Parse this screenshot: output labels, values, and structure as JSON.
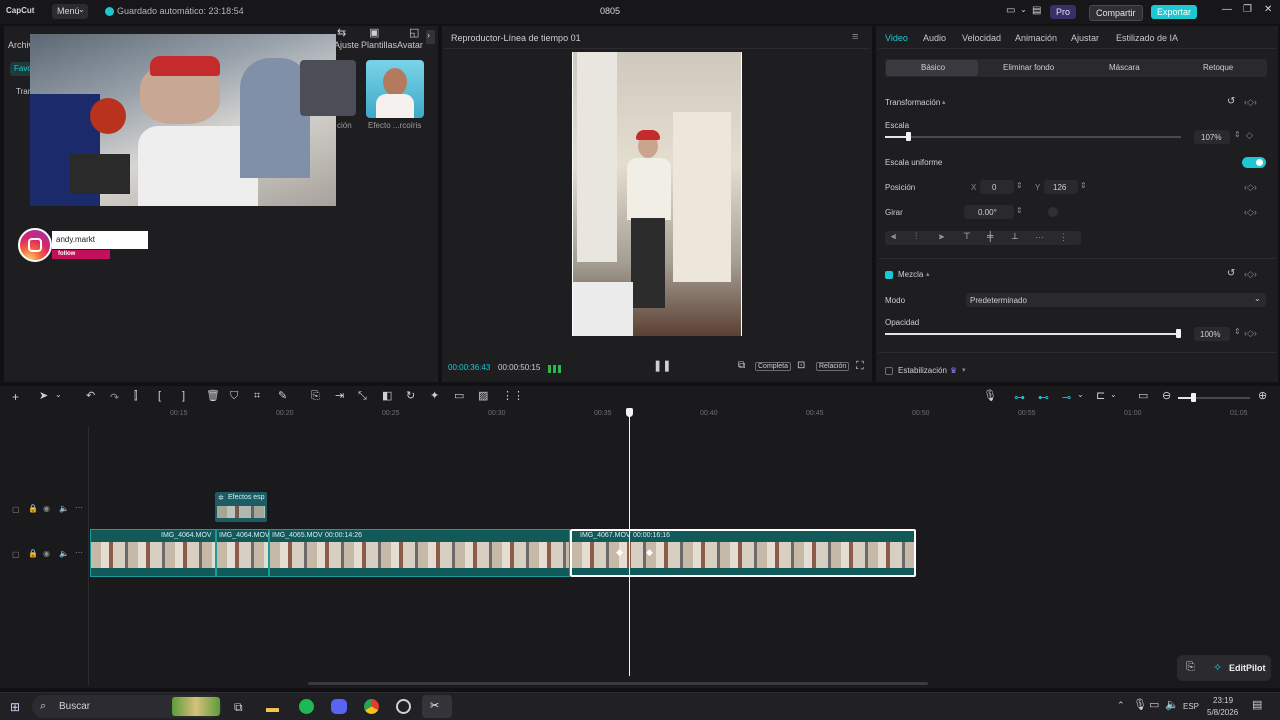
{
  "titlebar": {
    "app_logo": "CapCut",
    "menu_label": "Menú",
    "autosave": "Guardado automático: 23:18:54",
    "project_name": "0805",
    "pro_label": "Pro",
    "share_label": "Compartir",
    "export_label": "Exportar"
  },
  "media": {
    "tabs": [
      "Archivo",
      "Ajuste",
      "Plantillas",
      "Avatar"
    ],
    "side_tabs": [
      "Favo",
      "Tran"
    ],
    "cards": [
      {
        "label": "ción"
      },
      {
        "label": "Efecto ...rcoíris"
      }
    ],
    "overlay_username": "andy.markt",
    "overlay_follow": "follow"
  },
  "player": {
    "title": "Reproductor-Línea de tiempo 01",
    "current_time": "00:00:36:43",
    "total_time": "00:00:50:15",
    "btn_complete": "Completa",
    "btn_ratio": "Relación"
  },
  "props": {
    "tabs": [
      "Video",
      "Audio",
      "Velocidad",
      "Animación",
      "Ajustar",
      "Estilizado de IA"
    ],
    "active_tab": "Video",
    "subtabs": [
      "Básico",
      "Eliminar fondo",
      "Máscara",
      "Retoque"
    ],
    "section_transform": "Transformación",
    "scale_label": "Escala",
    "scale_value": "107%",
    "scale_fraction": 0.07,
    "uniform_scale_label": "Escala uniforme",
    "position_label": "Posición",
    "pos_x_label": "X",
    "pos_x": "0",
    "pos_y_label": "Y",
    "pos_y": "126",
    "rotate_label": "Girar",
    "rotate_value": "0.00°",
    "section_blend": "Mezcla",
    "mode_label": "Modo",
    "mode_value": "Predeterminado",
    "opacity_label": "Opacidad",
    "opacity_value": "100%",
    "opacity_fraction": 1.0,
    "stabilization_label": "Estabilización"
  },
  "timeline": {
    "ruler_ticks": [
      "00:15",
      "00:20",
      "00:25",
      "00:30",
      "00:35",
      "00:40",
      "00:45",
      "00:50",
      "00:55",
      "01:00",
      "01:05"
    ],
    "effect_clip_label": "Efectos esp",
    "clips": [
      {
        "name": "IMG_4064.MOV",
        "duration": ""
      },
      {
        "name": "IMG_4064.MOV",
        "duration": ""
      },
      {
        "name": "IMG_4065.MOV",
        "duration": "00:00:14:26"
      },
      {
        "name": "IMG_4067.MOV",
        "duration": "00:00:16:16"
      }
    ],
    "editpilot_label": "EditPilot"
  },
  "taskbar": {
    "search_label": "Buscar",
    "language": "ESP",
    "time": "23:19",
    "date": "5/8/2026"
  },
  "colors": {
    "accent": "#1ec8d2",
    "clip": "#12595a",
    "export_bg": "#1ec8d2"
  }
}
